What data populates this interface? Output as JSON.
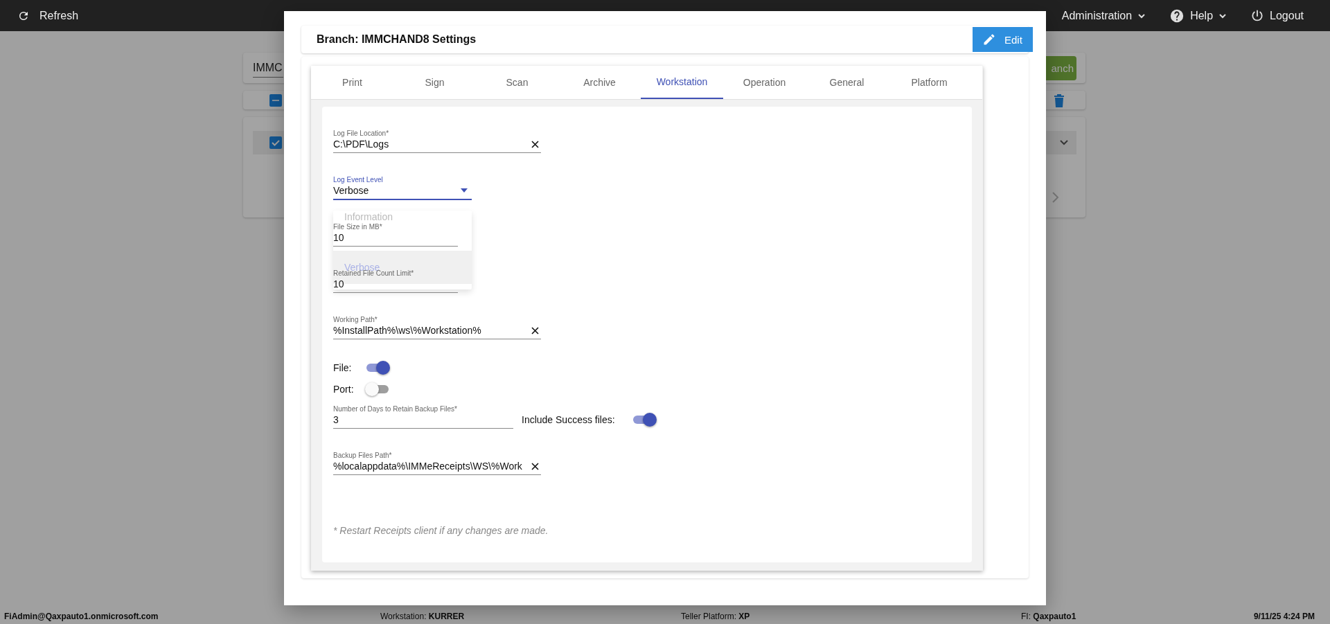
{
  "top_bar": {
    "refresh": "Refresh",
    "menus": [
      {
        "kind": "dropdown",
        "label": "Administration"
      },
      {
        "kind": "help",
        "label": "Help"
      },
      {
        "kind": "logout",
        "label": "Logout"
      }
    ]
  },
  "page": {
    "branch_field": "IMMC",
    "branch_button": "anch",
    "select_all": {
      "indeterminate": true
    },
    "row": {
      "checked": true
    }
  },
  "dialog": {
    "title": "Branch: IMMCHAND8 Settings",
    "edit_button": "Edit",
    "tabs": [
      {
        "label": "Print",
        "selected": false
      },
      {
        "label": "Sign",
        "selected": false
      },
      {
        "label": "Scan",
        "selected": false
      },
      {
        "label": "Archive",
        "selected": false
      },
      {
        "label": "Workstation",
        "selected": true
      },
      {
        "label": "Operation",
        "selected": false
      },
      {
        "label": "General",
        "selected": false
      },
      {
        "label": "Platform",
        "selected": false
      }
    ],
    "fields": [
      {
        "kind": "text",
        "label": "Log File Location*",
        "value": "C:\\PDF\\Logs",
        "clearable": true
      },
      {
        "kind": "select",
        "label": "Log Event Level",
        "value": "Verbose",
        "focused": true
      },
      {
        "kind": "text",
        "label": "File Size in MB*",
        "value": "10",
        "clearable": false
      },
      {
        "kind": "text",
        "label": "Retained File Count Limit*",
        "value": "10",
        "clearable": false
      },
      {
        "kind": "text",
        "label": "Working Path*",
        "value": "%InstallPath%\\ws\\%Workstation%",
        "clearable": true
      },
      {
        "kind": "toggle",
        "label": "File:",
        "on": true
      },
      {
        "kind": "toggle",
        "label": "Port:",
        "on": false
      },
      {
        "kind": "text",
        "label": "Number of Days to Retain Backup Files*",
        "value": "3",
        "clearable": false,
        "toggle": {
          "label": "Include Success files:",
          "on": true
        }
      },
      {
        "kind": "text",
        "label": "Backup Files Path*",
        "value": "%localappdata%\\IMMeReceipts\\WS\\%Work",
        "clearable": true
      }
    ],
    "menu": {
      "options": [
        {
          "label": "Information",
          "selected": false
        },
        {
          "label": "Verbose",
          "selected": true
        }
      ]
    },
    "note": "* Restart Receipts client if any changes are made."
  },
  "status_bar": {
    "user": "FiAdmin@Qaxpauto1.onmicrosoft.com",
    "items": [
      "Workstation: **KURRER**",
      "Teller Platform: **XP**",
      "FI: **Qaxpauto1**"
    ],
    "datetime": "9/11/25 4:24 PM"
  }
}
